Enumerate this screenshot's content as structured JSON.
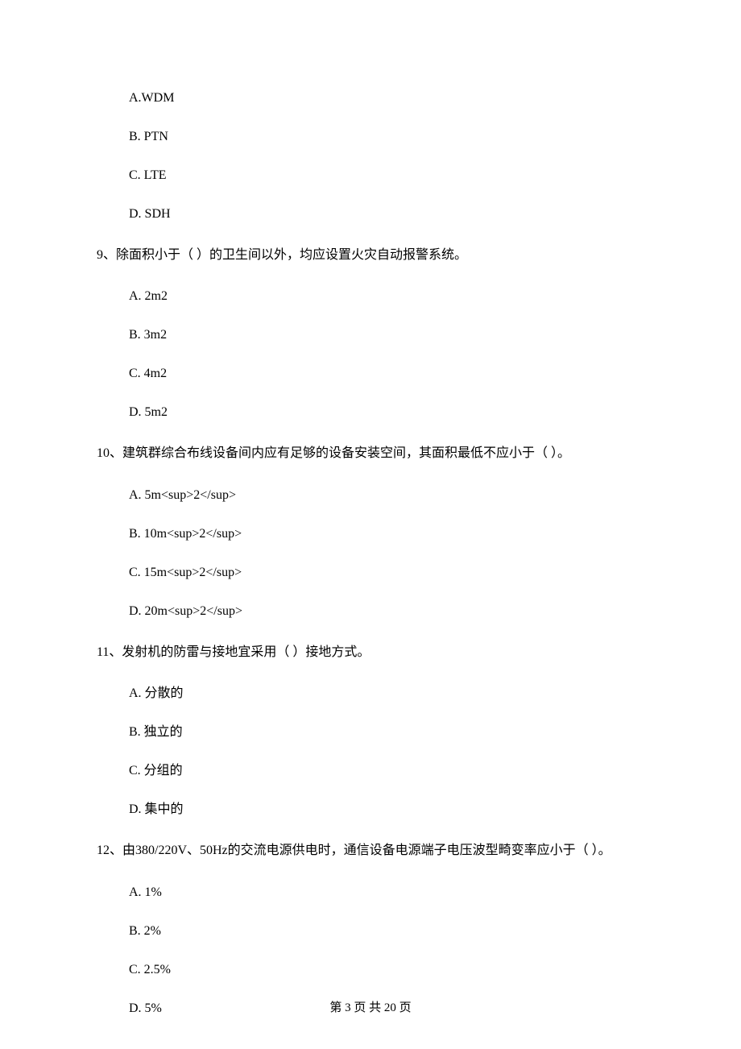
{
  "q8_options": {
    "a": "A.WDM",
    "b": "B. PTN",
    "c": "C. LTE",
    "d": "D. SDH"
  },
  "q9": {
    "text": "9、除面积小于（    ）的卫生间以外，均应设置火灾自动报警系统。",
    "a": "A. 2m2",
    "b": "B. 3m2",
    "c": "C. 4m2",
    "d": "D. 5m2"
  },
  "q10": {
    "text": "10、建筑群综合布线设备间内应有足够的设备安装空间，其面积最低不应小于（    ）。",
    "a": "A. 5m<sup>2</sup>",
    "b": "B. 10m<sup>2</sup>",
    "c": "C. 15m<sup>2</sup>",
    "d": "D. 20m<sup>2</sup>"
  },
  "q11": {
    "text": "11、发射机的防雷与接地宜采用（    ）接地方式。",
    "a": "A. 分散的",
    "b": "B. 独立的",
    "c": "C. 分组的",
    "d": "D. 集中的"
  },
  "q12": {
    "text": "12、由380/220V、50Hz的交流电源供电时，通信设备电源端子电压波型畸变率应小于（    ）。",
    "a": "A. 1%",
    "b": "B. 2%",
    "c": "C. 2.5%",
    "d": "D. 5%"
  },
  "footer": "第 3 页 共 20 页"
}
